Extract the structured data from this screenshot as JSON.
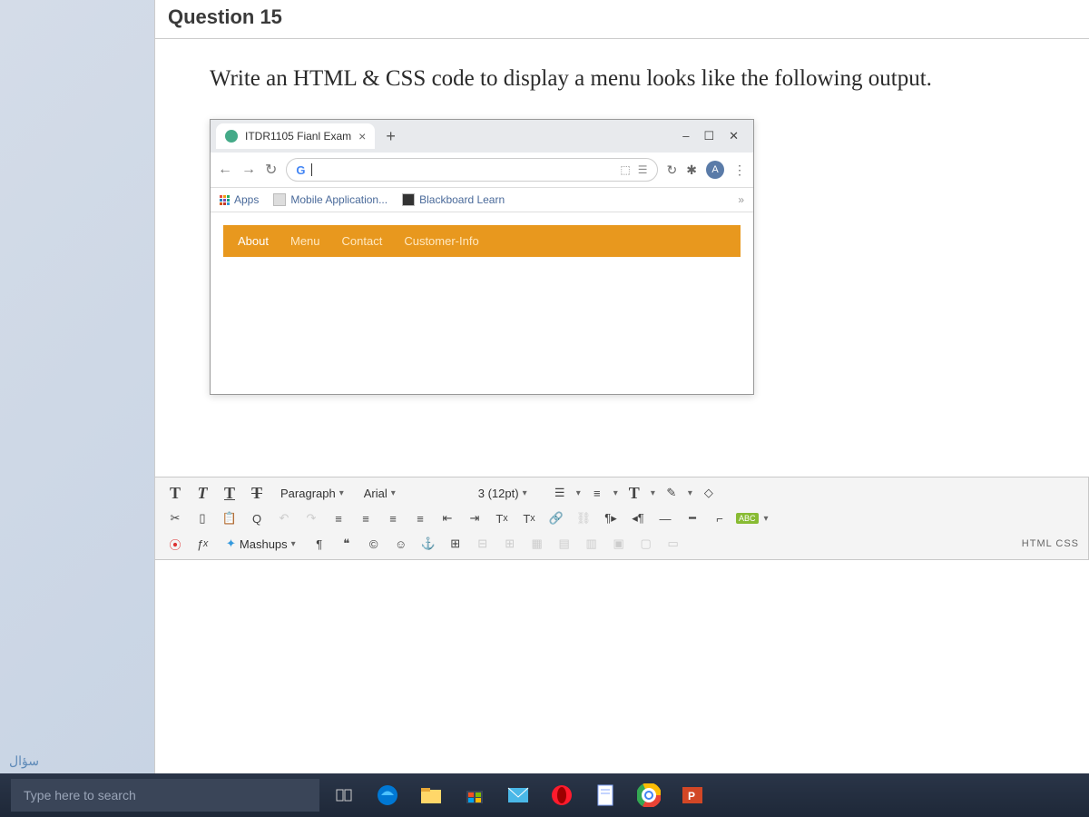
{
  "question": {
    "header": "Question 15",
    "text": "Write an HTML & CSS code to display a menu looks like the following output."
  },
  "browser": {
    "tab_title": "ITDR1105 Fianl Exam",
    "win_min": "–",
    "win_max": "☐",
    "win_close": "✕",
    "g_label": "G",
    "bookmarks": {
      "apps": "Apps",
      "mobile": "Mobile Application...",
      "blackboard": "Blackboard Learn"
    },
    "menu_items": [
      "About",
      "Menu",
      "Contact",
      "Customer-Info"
    ]
  },
  "toolbar": {
    "paragraph": "Paragraph",
    "font": "Arial",
    "size": "3 (12pt)",
    "mashups": "Mashups",
    "html_css": "HTML CSS",
    "abc": "ABC"
  },
  "taskbar": {
    "search_placeholder": "Type here to search"
  },
  "sidebar_hint": "سؤال"
}
